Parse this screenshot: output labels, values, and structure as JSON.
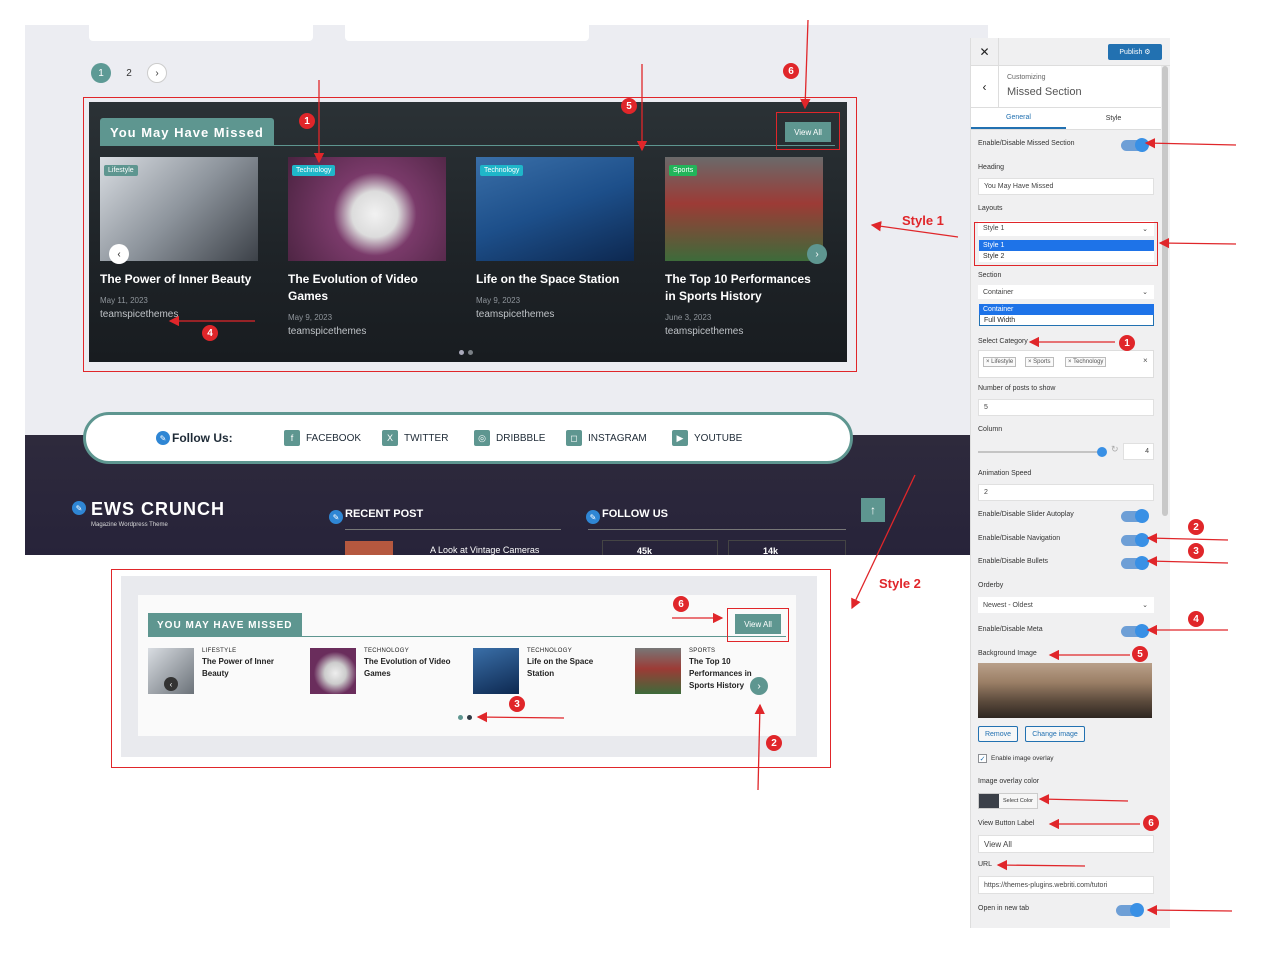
{
  "pagination": {
    "page1": "1",
    "page2": "2",
    "next": "›"
  },
  "style1": {
    "heading": "You May Have Missed",
    "view_all": "View All",
    "posts": [
      {
        "category": "Lifestyle",
        "title": "The Power of Inner Beauty",
        "date": "May 11, 2023",
        "author": "teamspicethemes",
        "cat_color": "#5e9690"
      },
      {
        "category": "Technology",
        "title": "The Evolution of Video Games",
        "date": "May 9, 2023",
        "author": "teamspicethemes",
        "cat_color": "#1fb6c9"
      },
      {
        "category": "Technology",
        "title": "Life on the Space Station",
        "date": "May 9, 2023",
        "author": "teamspicethemes",
        "cat_color": "#1fb6c9"
      },
      {
        "category": "Sports",
        "title": "The Top 10 Performances in Sports History",
        "date": "June 3, 2023",
        "author": "teamspicethemes",
        "cat_color": "#22b55a"
      }
    ]
  },
  "follow": {
    "label": "Follow Us:",
    "items": [
      {
        "name": "FACEBOOK",
        "icon": "f"
      },
      {
        "name": "TWITTER",
        "icon": "X"
      },
      {
        "name": "DRIBBBLE",
        "icon": "◎"
      },
      {
        "name": "INSTAGRAM",
        "icon": "◻"
      },
      {
        "name": "YOUTUBE",
        "icon": "▶"
      }
    ]
  },
  "footer": {
    "logo_main": "EWS CRUNCH",
    "logo_sub": "Magazine Wordpress Theme",
    "recent_post": "RECENT POST",
    "follow_us": "FOLLOW US",
    "recent_item": "A Look at Vintage Cameras",
    "stat1": "45k",
    "stat2": "14k"
  },
  "style2": {
    "heading": "YOU MAY HAVE MISSED",
    "view_all": "View All",
    "posts": [
      {
        "category": "LIFESTYLE",
        "title": "The Power of Inner Beauty"
      },
      {
        "category": "TECHNOLOGY",
        "title": "The Evolution of Video Games"
      },
      {
        "category": "TECHNOLOGY",
        "title": "Life on the Space Station"
      },
      {
        "category": "SPORTS",
        "title": "The Top 10 Performances in Sports History"
      }
    ]
  },
  "panel": {
    "publish": "Publish",
    "crumb": "Customizing",
    "section_title": "Missed Section",
    "tab_general": "General",
    "tab_style": "Style",
    "enable_missed": "Enable/Disable Missed Section",
    "heading_label": "Heading",
    "heading_value": "You May Have Missed",
    "layouts_label": "Layouts",
    "layouts_value": "Style 1",
    "layout_options": [
      "Style 1",
      "Style 2"
    ],
    "section_label": "Section",
    "section_value": "Container",
    "section_options": [
      "Container",
      "Full Width"
    ],
    "category_label": "Select Category",
    "categories": [
      "× Lifestyle",
      "× Sports",
      "× Technology"
    ],
    "num_posts_label": "Number of posts to show",
    "num_posts": "5",
    "column_label": "Column",
    "column_value": "4",
    "anim_label": "Animation Speed",
    "anim_value": "2",
    "autoplay_label": "Enable/Disable Slider Autoplay",
    "navigation_label": "Enable/Disable Navigation",
    "bullets_label": "Enable/Disable Bullets",
    "orderby_label": "Orderby",
    "orderby_value": "Newest - Oldest",
    "meta_label": "Enable/Disable Meta",
    "bg_label": "Background Image",
    "remove": "Remove",
    "change_image": "Change image",
    "overlay_check": "Enable image overlay",
    "overlay_color_label": "Image overlay color",
    "select_color": "Select Color",
    "view_btn_label": "View Button Label",
    "view_btn_value": "View All",
    "url_label": "URL",
    "url_value": "https://themes-plugins.webriti.com/tutori",
    "newtab_label": "Open in new tab"
  },
  "annotations": {
    "style1": "Style 1",
    "style2": "Style 2",
    "n1": "1",
    "n2": "2",
    "n3": "3",
    "n4": "4",
    "n5": "5",
    "n6": "6"
  },
  "colors": {
    "accent": "#5e9690",
    "annotation": "#e0262a",
    "wp_blue": "#2271b1"
  }
}
